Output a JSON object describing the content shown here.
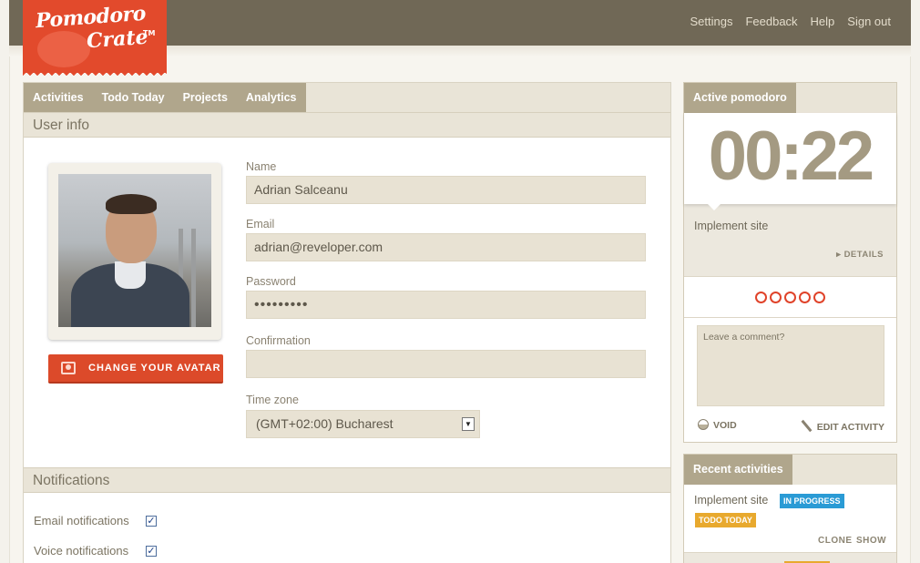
{
  "brand": {
    "logo_line1": "Pomodoro",
    "logo_line2": "Crate",
    "logo_tm": "TM",
    "color": "#e24a2c"
  },
  "top_nav": [
    "Settings",
    "Feedback",
    "Help",
    "Sign out"
  ],
  "tabs": [
    "Activities",
    "Todo Today",
    "Projects",
    "Analytics"
  ],
  "user_info": {
    "heading": "User info",
    "change_avatar_label": "CHANGE YOUR AVATAR",
    "name_label": "Name",
    "name_value": "Adrian Salceanu",
    "email_label": "Email",
    "email_value": "adrian@reveloper.com",
    "password_label": "Password",
    "password_value": "•••••••••",
    "confirmation_label": "Confirmation",
    "confirmation_value": "",
    "timezone_label": "Time zone",
    "timezone_value": "(GMT+02:00) Bucharest"
  },
  "notifications": {
    "heading": "Notifications",
    "email_label": "Email notifications",
    "email_checked": true,
    "voice_label": "Voice notifications",
    "voice_checked": true
  },
  "active_pomodoro": {
    "heading": "Active pomodoro",
    "timer": "00:22",
    "task": "Implement site",
    "details_label": "DETAILS",
    "pomodoro_count": 5,
    "comment_placeholder": "Leave a comment?",
    "void_label": "VOID",
    "edit_label": "EDIT ACTIVITY"
  },
  "recent_activities": {
    "heading": "Recent activities",
    "item_name": "Implement site",
    "badge_status": "IN PROGRESS",
    "badge_todo": "TODO TODAY",
    "clone_label": "CLONE",
    "show_label": "SHOW"
  },
  "colors": {
    "topbar": "#706856",
    "tab_bg": "#b0a68c",
    "accent_red": "#dc4a2a",
    "badge_blue": "#2a9bd5",
    "badge_yellow": "#e8a92e"
  }
}
